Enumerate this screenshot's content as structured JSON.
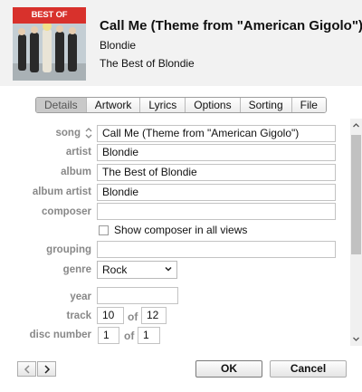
{
  "header": {
    "art_banner": "BEST OF BLONDIE",
    "title": "Call Me (Theme from \"American Gigolo\")",
    "artist": "Blondie",
    "album": "The Best of Blondie"
  },
  "tabs": [
    {
      "label": "Details",
      "active": true
    },
    {
      "label": "Artwork",
      "active": false
    },
    {
      "label": "Lyrics",
      "active": false
    },
    {
      "label": "Options",
      "active": false
    },
    {
      "label": "Sorting",
      "active": false
    },
    {
      "label": "File",
      "active": false
    }
  ],
  "fields": {
    "song": {
      "label": "song",
      "value": "Call Me (Theme from \"American Gigolo\")"
    },
    "artist": {
      "label": "artist",
      "value": "Blondie"
    },
    "album": {
      "label": "album",
      "value": "The Best of Blondie"
    },
    "album_artist": {
      "label": "album artist",
      "value": "Blondie"
    },
    "composer": {
      "label": "composer",
      "value": ""
    },
    "show_composer": {
      "label": "Show composer in all views",
      "checked": false
    },
    "grouping": {
      "label": "grouping",
      "value": ""
    },
    "genre": {
      "label": "genre",
      "value": "Rock"
    },
    "year": {
      "label": "year",
      "value": ""
    },
    "track": {
      "label": "track",
      "value": "10",
      "of_label": "of",
      "total": "12"
    },
    "disc": {
      "label": "disc number",
      "value": "1",
      "of_label": "of",
      "total": "1"
    }
  },
  "buttons": {
    "ok": "OK",
    "cancel": "Cancel"
  },
  "icons": {
    "prev": "chevron-left-icon",
    "next": "chevron-right-icon",
    "sort": "sort-updown-icon",
    "genre_dropdown": "chevron-down-icon"
  }
}
